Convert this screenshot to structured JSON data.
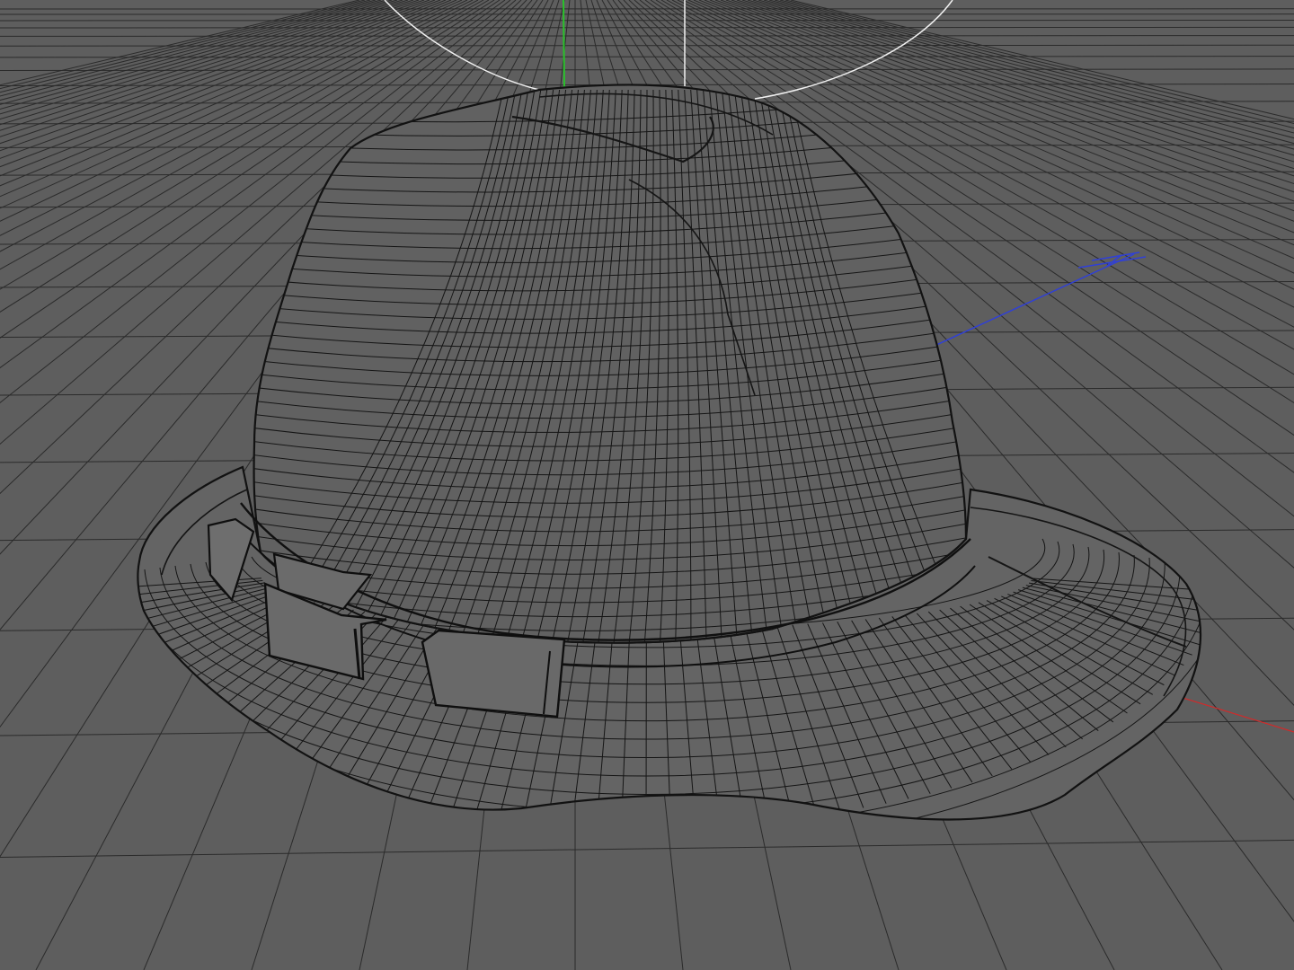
{
  "viewport": {
    "background": "#5e5e5e",
    "grid_color": "#2b2b2b",
    "wire_color": "#151515",
    "gizmo_ring_color": "#f2f2f2",
    "axis_colors": {
      "x": "#d12a2a",
      "y": "#29c22a",
      "z": "#3040d6"
    }
  },
  "scene": {
    "object": "hat",
    "display_mode": "wireframe",
    "icons": [
      "rotate-gizmo-icon",
      "axis-x-icon",
      "axis-y-icon",
      "axis-z-icon"
    ]
  }
}
